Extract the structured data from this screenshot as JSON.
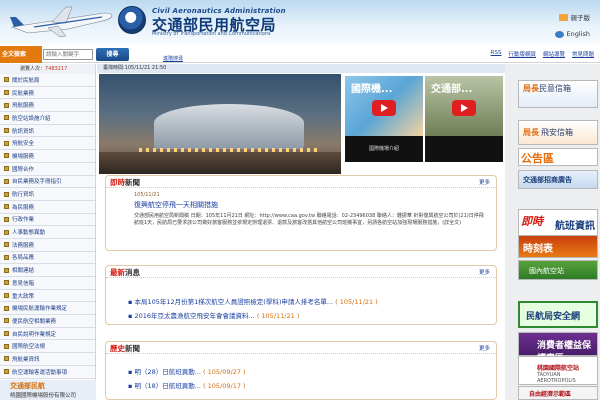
{
  "header": {
    "logo_en": "Civil Aeronautics Administration",
    "logo_zh": "交通部民用航空局",
    "logo_en_sub": "Ministry of Transportation and Communications",
    "lang_kids": "親子版",
    "lang_en": "English"
  },
  "navbar": {
    "site_label": "全文檢索",
    "search_placeholder": "請輸入關鍵字",
    "search_button": "搜尋",
    "sub_link": "進階搜尋",
    "links": [
      "RSS",
      "行動版網頁",
      "網站導覽",
      "常見問題"
    ]
  },
  "sidebar": {
    "visitors_label": "瀏覽人次：",
    "visitors_count": "7483217",
    "items": [
      "關於民航局",
      "民航業務",
      "飛航服務",
      "航空站設施介紹",
      "航訊資訊",
      "飛航安全",
      "機場服務",
      "國際合作",
      "自民業務及手冊指引",
      "航行資訊",
      "為民服務",
      "行政作業",
      "人事動態異動",
      "法務服務",
      "各局品應",
      "相關連結",
      "意見信箱",
      "重大政策",
      "機場民航運輸作業規定",
      "便民航空相關業務",
      "自民說明作業規定",
      "國際航空法規",
      "飛航業資訊",
      "航空運輸客運活動事項",
      "航空活動"
    ],
    "bottom_title": "交通部民航",
    "bottom_sub": "桃園國際機場股份有限公司"
  },
  "main": {
    "time_label": "臺灣時間:105/11/21  21:50",
    "videos": [
      {
        "title": "國際機...",
        "caption": "國際機場介紹"
      },
      {
        "title": "交通部...",
        "caption": ""
      }
    ],
    "news": {
      "heading_em": "即時",
      "heading": "新聞",
      "more": "更多",
      "date": "105/11/21",
      "title": "復興航空停飛一天相關措施",
      "body": "交通部民用航空局新聞稿 日期：105年11月21日 網址：http://www.caa.gov.tw 聯絡電話：02-23496038 聯絡人：鍾振華 針對復興航空公司於(21)日停飛航班1天，民航局已要求該公司做好旅客服務並依規定辦理退票、退款及旅客改搭其他航空公司班機事宜，另請各航空站加強現場服務措施，(詳全文)"
    },
    "latest": {
      "heading_em": "最新",
      "heading": "消息",
      "more": "更多",
      "items": [
        {
          "text": "本局105年12月份第1梯次航空人員證照檢定(學科)申請人排考名單...",
          "date": "( 105/11/21 )"
        },
        {
          "text": "2016年亞太農漁航空飛安年會會議資料...",
          "date": "( 105/11/21 )"
        }
      ]
    },
    "history": {
      "heading_em": "歷史",
      "heading": "新聞",
      "more": "更多",
      "items": [
        {
          "text": "明（28）日航班異動...",
          "date": "( 105/09/27 )"
        },
        {
          "text": "明（18）日航班異動...",
          "date": "( 105/09/17 )"
        }
      ]
    }
  },
  "right": {
    "director_a": "局長",
    "director_b": "民意信箱",
    "mail_a": "局長",
    "mail_b": "飛安信箱",
    "notice": "公告區",
    "ads": "交通部招商廣告",
    "flight_a": "即時",
    "flight_b": "航班資訊",
    "weather": "時刻表",
    "map": "國內航空站",
    "safety": "民航局安全網",
    "consumer": "消費者權益保護專區",
    "taoyuan_a": "桃園國際航空站",
    "taoyuan_b": "TAOYUAN AEROTROPOLIS",
    "free": "自由經濟示範區"
  }
}
